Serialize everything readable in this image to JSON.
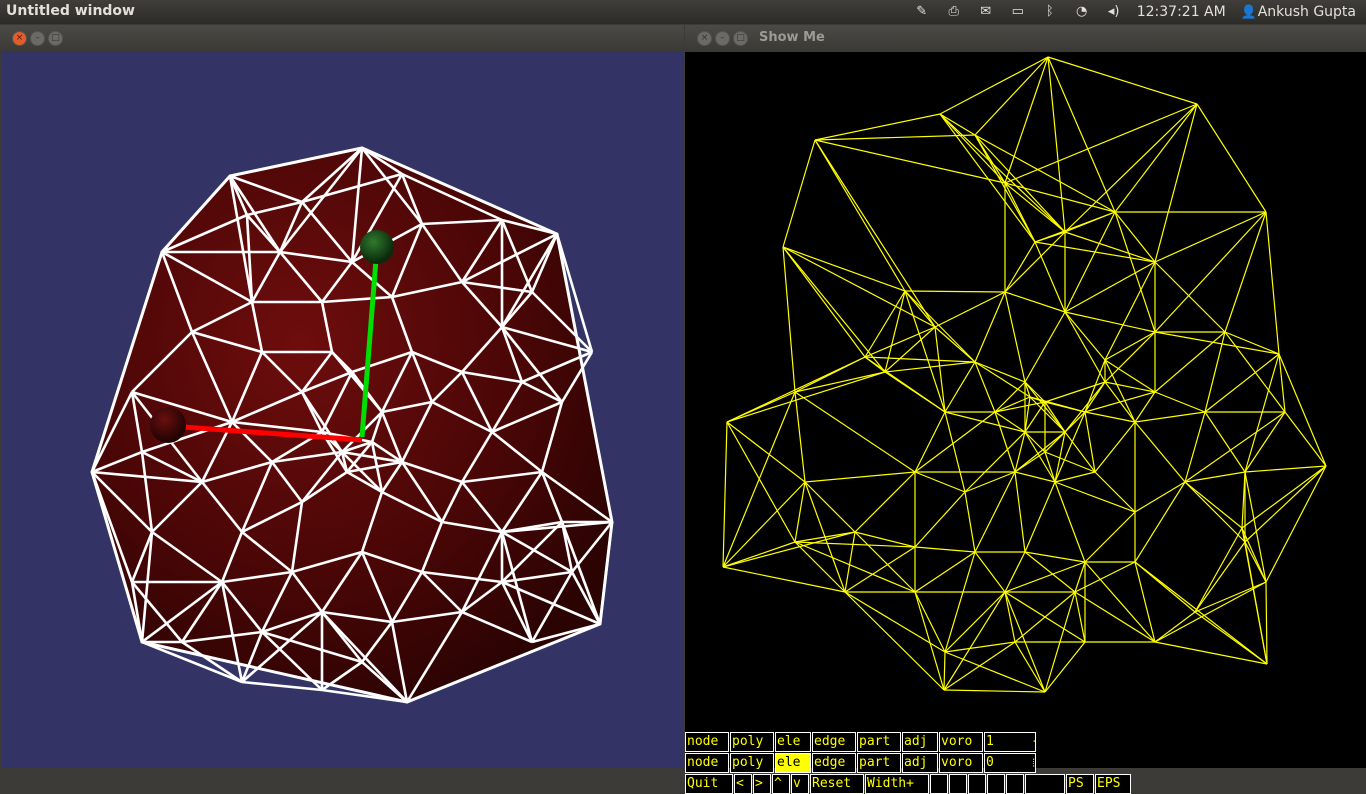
{
  "topbar": {
    "app_title": "Untitled window",
    "clock": "12:37:21 AM",
    "user": "Ankush Gupta",
    "icons": [
      "notes-icon",
      "printer-icon",
      "mail-icon",
      "battery-icon",
      "bluetooth-icon",
      "wifi-icon",
      "volume-icon",
      "user-icon"
    ]
  },
  "left_window": {
    "title": "",
    "background": "#333366",
    "mesh_color": "#ffffff",
    "fill_color": "#5a0a0a",
    "axis_x_color": "#ff0000",
    "axis_y_color": "#00dd00"
  },
  "right_window": {
    "title": "Show Me",
    "background": "#000000",
    "wire_color": "#ffff00",
    "row1": [
      "node",
      "poly",
      "ele",
      "edge",
      "part",
      "adj",
      "voro",
      "1     +"
    ],
    "row2": [
      "node",
      "poly",
      "ele",
      "edge",
      "part",
      "adj",
      "voro",
      "0     ⬚"
    ],
    "row2_active_index": 2,
    "row3": [
      "Quit",
      "<",
      ">",
      "^",
      "v",
      "Reset",
      "Width+",
      "",
      "",
      "",
      "",
      "",
      "",
      "PS",
      "EPS"
    ]
  }
}
